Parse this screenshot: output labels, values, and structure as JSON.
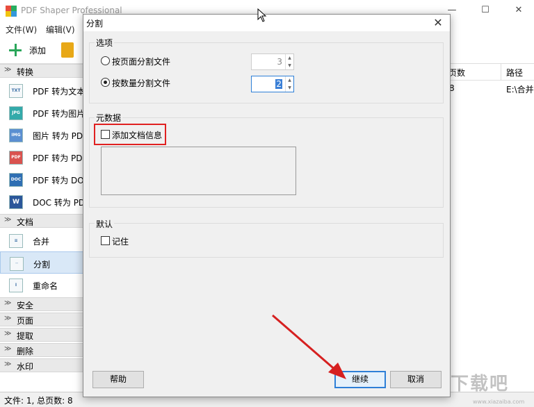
{
  "app": {
    "title": "PDF Shaper Professional",
    "window_controls": {
      "minimize": "—",
      "maximize": "☐",
      "close": "✕"
    }
  },
  "menu": [
    "文件(W)",
    "编辑(V)"
  ],
  "toolbar": {
    "add_label": "添加"
  },
  "sidebar": {
    "sections": [
      {
        "label": "转换",
        "chevron": "≫"
      },
      {
        "label": "文档",
        "chevron": "≫"
      },
      {
        "label": "安全",
        "chevron": "≫"
      },
      {
        "label": "页面",
        "chevron": "≫"
      },
      {
        "label": "提取",
        "chevron": "≫"
      },
      {
        "label": "删除",
        "chevron": "≫"
      },
      {
        "label": "水印",
        "chevron": "≫"
      }
    ],
    "convert_items": [
      {
        "label": "PDF 转为文本",
        "icon": "TXT"
      },
      {
        "label": "PDF 转为图片",
        "icon": "JPG"
      },
      {
        "label": "图片 转为 PDF",
        "icon": "IMG"
      },
      {
        "label": "PDF 转为 PDF",
        "icon": "PDF"
      },
      {
        "label": "PDF 转为 DOC",
        "icon": "DOC"
      },
      {
        "label": "DOC 转为 PDF",
        "icon": "W"
      }
    ],
    "doc_items": [
      {
        "label": "合并",
        "icon": "≡"
      },
      {
        "label": "分割",
        "icon": "┄"
      },
      {
        "label": "重命名",
        "icon": "I"
      }
    ]
  },
  "list": {
    "columns": [
      "页数",
      "路径"
    ],
    "row": {
      "pages": "8",
      "path": "E:\\合并"
    }
  },
  "statusbar": {
    "text": "文件: 1, 总页数: 8"
  },
  "watermark": {
    "text": "下载吧",
    "sub": "www.xiazaiba.com"
  },
  "dialog": {
    "title": "分割",
    "close": "✕",
    "options_group": {
      "label": "选项",
      "by_page": {
        "label": "按页面分割文件",
        "selected": false,
        "value": "3"
      },
      "by_count": {
        "label": "按数量分割文件",
        "selected": true,
        "value": "2"
      }
    },
    "metadata_group": {
      "label": "元数据",
      "add_doc_info": {
        "label": "添加文档信息",
        "checked": false
      }
    },
    "default_group": {
      "label": "默认",
      "remember": {
        "label": "记住",
        "checked": false
      }
    },
    "buttons": {
      "help": "帮助",
      "continue": "继续",
      "cancel": "取消"
    }
  },
  "colors": {
    "highlight": "#e02020",
    "accent": "#2d7fd7",
    "arrow": "#d62020"
  }
}
